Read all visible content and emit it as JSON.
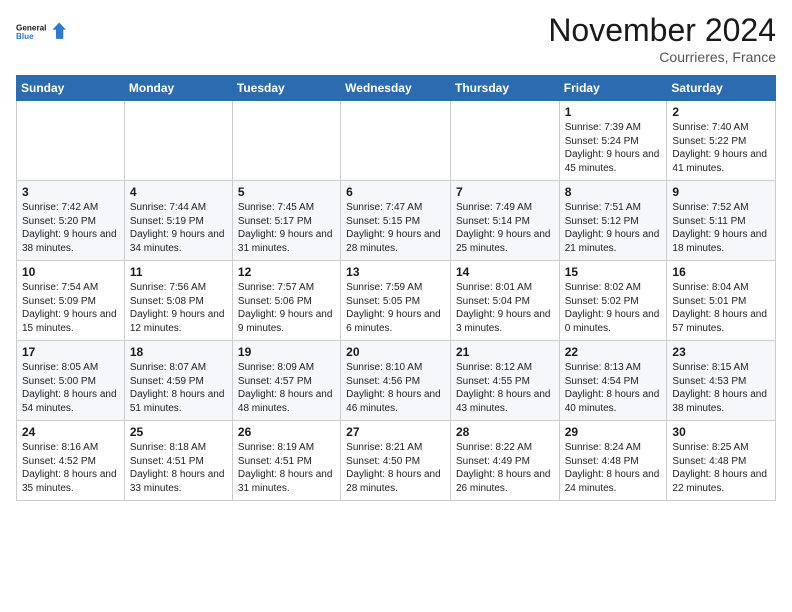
{
  "header": {
    "logo_line1": "General",
    "logo_line2": "Blue",
    "month_title": "November 2024",
    "location": "Courrieres, France"
  },
  "weekdays": [
    "Sunday",
    "Monday",
    "Tuesday",
    "Wednesday",
    "Thursday",
    "Friday",
    "Saturday"
  ],
  "weeks": [
    [
      {
        "day": "",
        "info": ""
      },
      {
        "day": "",
        "info": ""
      },
      {
        "day": "",
        "info": ""
      },
      {
        "day": "",
        "info": ""
      },
      {
        "day": "",
        "info": ""
      },
      {
        "day": "1",
        "info": "Sunrise: 7:39 AM\nSunset: 5:24 PM\nDaylight: 9 hours\nand 45 minutes."
      },
      {
        "day": "2",
        "info": "Sunrise: 7:40 AM\nSunset: 5:22 PM\nDaylight: 9 hours\nand 41 minutes."
      }
    ],
    [
      {
        "day": "3",
        "info": "Sunrise: 7:42 AM\nSunset: 5:20 PM\nDaylight: 9 hours\nand 38 minutes."
      },
      {
        "day": "4",
        "info": "Sunrise: 7:44 AM\nSunset: 5:19 PM\nDaylight: 9 hours\nand 34 minutes."
      },
      {
        "day": "5",
        "info": "Sunrise: 7:45 AM\nSunset: 5:17 PM\nDaylight: 9 hours\nand 31 minutes."
      },
      {
        "day": "6",
        "info": "Sunrise: 7:47 AM\nSunset: 5:15 PM\nDaylight: 9 hours\nand 28 minutes."
      },
      {
        "day": "7",
        "info": "Sunrise: 7:49 AM\nSunset: 5:14 PM\nDaylight: 9 hours\nand 25 minutes."
      },
      {
        "day": "8",
        "info": "Sunrise: 7:51 AM\nSunset: 5:12 PM\nDaylight: 9 hours\nand 21 minutes."
      },
      {
        "day": "9",
        "info": "Sunrise: 7:52 AM\nSunset: 5:11 PM\nDaylight: 9 hours\nand 18 minutes."
      }
    ],
    [
      {
        "day": "10",
        "info": "Sunrise: 7:54 AM\nSunset: 5:09 PM\nDaylight: 9 hours\nand 15 minutes."
      },
      {
        "day": "11",
        "info": "Sunrise: 7:56 AM\nSunset: 5:08 PM\nDaylight: 9 hours\nand 12 minutes."
      },
      {
        "day": "12",
        "info": "Sunrise: 7:57 AM\nSunset: 5:06 PM\nDaylight: 9 hours\nand 9 minutes."
      },
      {
        "day": "13",
        "info": "Sunrise: 7:59 AM\nSunset: 5:05 PM\nDaylight: 9 hours\nand 6 minutes."
      },
      {
        "day": "14",
        "info": "Sunrise: 8:01 AM\nSunset: 5:04 PM\nDaylight: 9 hours\nand 3 minutes."
      },
      {
        "day": "15",
        "info": "Sunrise: 8:02 AM\nSunset: 5:02 PM\nDaylight: 9 hours\nand 0 minutes."
      },
      {
        "day": "16",
        "info": "Sunrise: 8:04 AM\nSunset: 5:01 PM\nDaylight: 8 hours\nand 57 minutes."
      }
    ],
    [
      {
        "day": "17",
        "info": "Sunrise: 8:05 AM\nSunset: 5:00 PM\nDaylight: 8 hours\nand 54 minutes."
      },
      {
        "day": "18",
        "info": "Sunrise: 8:07 AM\nSunset: 4:59 PM\nDaylight: 8 hours\nand 51 minutes."
      },
      {
        "day": "19",
        "info": "Sunrise: 8:09 AM\nSunset: 4:57 PM\nDaylight: 8 hours\nand 48 minutes."
      },
      {
        "day": "20",
        "info": "Sunrise: 8:10 AM\nSunset: 4:56 PM\nDaylight: 8 hours\nand 46 minutes."
      },
      {
        "day": "21",
        "info": "Sunrise: 8:12 AM\nSunset: 4:55 PM\nDaylight: 8 hours\nand 43 minutes."
      },
      {
        "day": "22",
        "info": "Sunrise: 8:13 AM\nSunset: 4:54 PM\nDaylight: 8 hours\nand 40 minutes."
      },
      {
        "day": "23",
        "info": "Sunrise: 8:15 AM\nSunset: 4:53 PM\nDaylight: 8 hours\nand 38 minutes."
      }
    ],
    [
      {
        "day": "24",
        "info": "Sunrise: 8:16 AM\nSunset: 4:52 PM\nDaylight: 8 hours\nand 35 minutes."
      },
      {
        "day": "25",
        "info": "Sunrise: 8:18 AM\nSunset: 4:51 PM\nDaylight: 8 hours\nand 33 minutes."
      },
      {
        "day": "26",
        "info": "Sunrise: 8:19 AM\nSunset: 4:51 PM\nDaylight: 8 hours\nand 31 minutes."
      },
      {
        "day": "27",
        "info": "Sunrise: 8:21 AM\nSunset: 4:50 PM\nDaylight: 8 hours\nand 28 minutes."
      },
      {
        "day": "28",
        "info": "Sunrise: 8:22 AM\nSunset: 4:49 PM\nDaylight: 8 hours\nand 26 minutes."
      },
      {
        "day": "29",
        "info": "Sunrise: 8:24 AM\nSunset: 4:48 PM\nDaylight: 8 hours\nand 24 minutes."
      },
      {
        "day": "30",
        "info": "Sunrise: 8:25 AM\nSunset: 4:48 PM\nDaylight: 8 hours\nand 22 minutes."
      }
    ]
  ]
}
